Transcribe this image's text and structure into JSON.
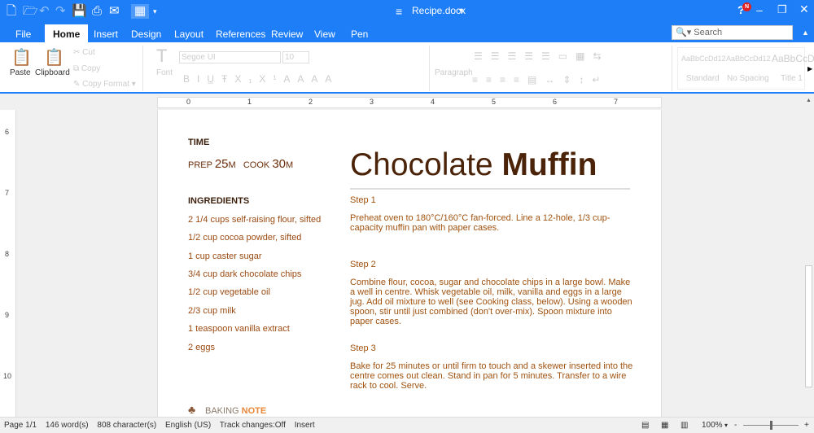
{
  "titlebar": {
    "doc_title": "Recipe.docx",
    "notif_badge": "N"
  },
  "tabs": [
    "File",
    "Home",
    "Insert",
    "Design",
    "Layout",
    "References",
    "Review",
    "View",
    "Pen"
  ],
  "search": {
    "placeholder": "Search"
  },
  "ribbon": {
    "paste": "Paste",
    "clipboard": "Clipboard",
    "cut": "Cut",
    "copy": "Copy",
    "copy_format": "Copy Format",
    "font_group": "Font",
    "font_name": "Segoe UI",
    "font_size": "10",
    "paragraph": "Paragraph",
    "styles": [
      {
        "preview": "AaBbCcDd12",
        "name": "Standard"
      },
      {
        "preview": "AaBbCcDd12",
        "name": "No Spacing"
      },
      {
        "preview": "AaBbCcD",
        "name": "Title 1"
      }
    ]
  },
  "ruler": {
    "h": [
      "0",
      "1",
      "2",
      "3",
      "4",
      "5",
      "6",
      "7"
    ],
    "v": [
      "6",
      "7",
      "8",
      "9",
      "10"
    ]
  },
  "doc": {
    "time_heading": "TIME",
    "prep_label": "PREP",
    "prep_val": "25",
    "prep_unit": "M",
    "cook_label": "COOK",
    "cook_val": "30",
    "cook_unit": "M",
    "title_light": "Chocolate",
    "title_bold": "Muffin",
    "ingredients_heading": "INGREDIENTS",
    "ingredients": [
      "2 1/4 cups self-raising flour, sifted",
      "1/2 cup cocoa powder, sifted",
      "1 cup caster sugar",
      "3/4 cup dark chocolate chips",
      "1/2 cup vegetable oil",
      "2/3 cup milk",
      "1 teaspoon vanilla extract",
      "2 eggs"
    ],
    "steps": [
      {
        "title": "Step 1",
        "text": "Preheat oven to 180°C/160°C fan-forced. Line a 12-hole, 1/3 cup-capacity muffin pan with paper cases."
      },
      {
        "title": "Step 2",
        "text": "Combine flour, cocoa, sugar and chocolate chips in a large bowl. Make a well in centre. Whisk vegetable oil, milk, vanilla and eggs in a large jug. Add oil mixture to well (see Cooking class, below). Using a wooden spoon, stir until just combined (don't over-mix). Spoon mixture into paper cases."
      },
      {
        "title": "Step 3",
        "text": "Bake for 25 minutes or until firm to touch and a skewer inserted into the centre comes out clean. Stand in pan for 5 minutes. Transfer to a wire rack to cool. Serve."
      }
    ],
    "baking_a": "BAKING",
    "baking_b": "NOTE"
  },
  "status": {
    "page": "Page 1/1",
    "words": "146 word(s)",
    "chars": "808 character(s)",
    "lang": "English (US)",
    "track": "Track changes:Off",
    "mode": "Insert",
    "zoom": "100%"
  }
}
